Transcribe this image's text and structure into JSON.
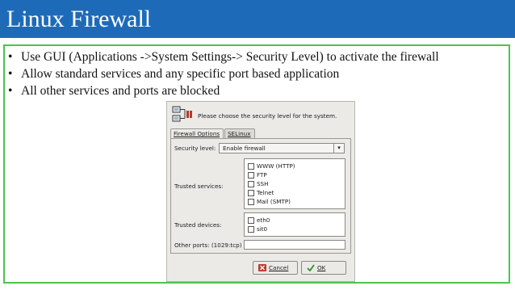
{
  "slide": {
    "title": "Linux Firewall",
    "bullets": [
      "Use GUI (Applications ->System Settings-> Security Level) to activate the firewall",
      "Allow standard services and any specific port based application",
      "All other services and ports are blocked"
    ],
    "bullet_symbol": "•",
    "colors": {
      "title_bar": "#1d6bb8",
      "frame": "#4cc44c"
    }
  },
  "dialog": {
    "message": "Please choose the security level for the system.",
    "tabs": [
      "Firewall Options",
      "SELinux"
    ],
    "security_level_label": "Security level:",
    "security_level_value": "Enable firewall",
    "trusted_services_label": "Trusted services:",
    "trusted_services": [
      {
        "label": "WWW (HTTP)",
        "checked": false
      },
      {
        "label": "FTP",
        "checked": false
      },
      {
        "label": "SSH",
        "checked": false
      },
      {
        "label": "Telnet",
        "checked": false
      },
      {
        "label": "Mail (SMTP)",
        "checked": false
      }
    ],
    "trusted_devices_label": "Trusted devices:",
    "trusted_devices": [
      {
        "label": "eth0",
        "checked": false
      },
      {
        "label": "sit0",
        "checked": false
      }
    ],
    "other_ports_label": "Other ports: (1029:tcp)",
    "other_ports_value": "",
    "cancel_label": "Cancel",
    "ok_label": "OK"
  }
}
